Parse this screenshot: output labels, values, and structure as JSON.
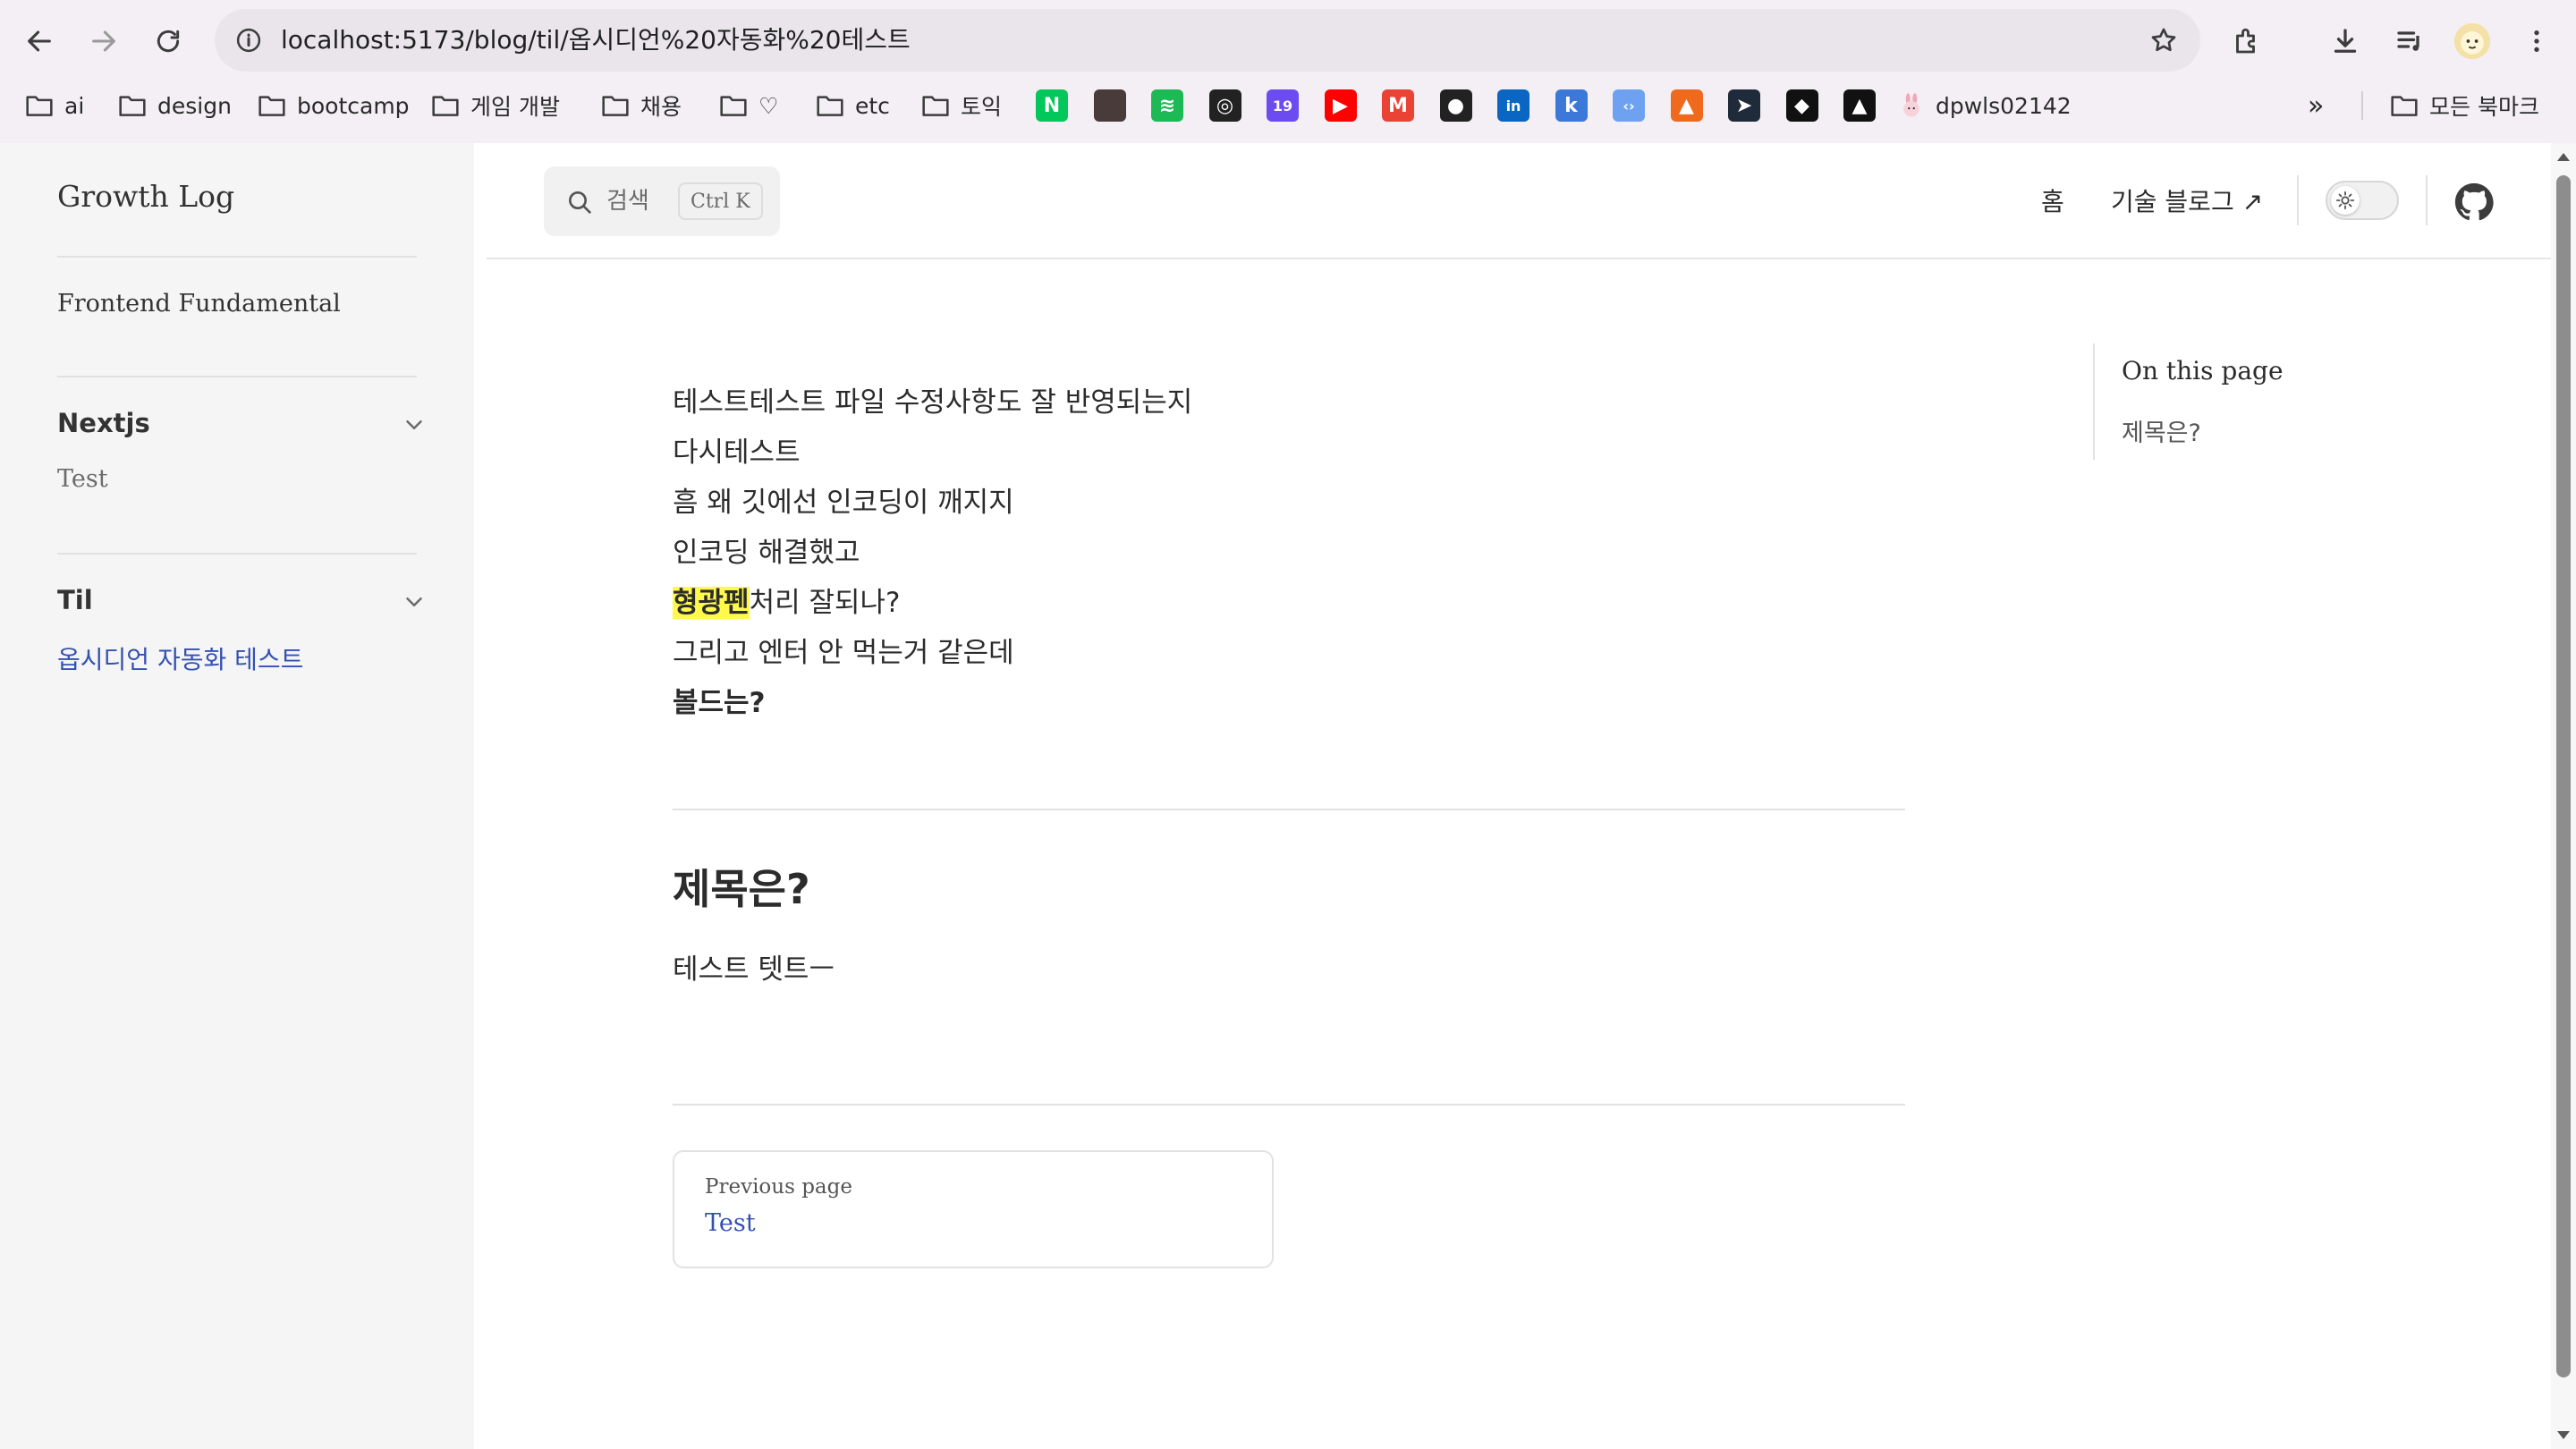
{
  "browser": {
    "url": "localhost:5173/blog/til/옵시디언%20자동화%20테스트",
    "bookmarks": [
      {
        "label": "ai",
        "icon": "folder-icon"
      },
      {
        "label": "design",
        "icon": "folder-icon"
      },
      {
        "label": "bootcamp",
        "icon": "folder-icon"
      },
      {
        "label": "게임 개발",
        "icon": "folder-icon"
      },
      {
        "label": "채용",
        "icon": "folder-icon"
      },
      {
        "label": "♡",
        "icon": "folder-icon"
      },
      {
        "label": "etc",
        "icon": "folder-icon"
      },
      {
        "label": "토익",
        "icon": "folder-icon"
      }
    ],
    "favicons": [
      {
        "name": "naver-icon",
        "glyph": "N",
        "color": "#03c75a"
      },
      {
        "name": "profile-image-icon",
        "glyph": "",
        "color": "#4a3b3b"
      },
      {
        "name": "spotify-icon",
        "glyph": "≋",
        "color": "#1db954"
      },
      {
        "name": "target-icon",
        "glyph": "◎",
        "color": "#222222"
      },
      {
        "name": "notification-19-icon",
        "glyph": "19",
        "color": "#6c4cf0"
      },
      {
        "name": "youtube-icon",
        "glyph": "▶",
        "color": "#ff0000"
      },
      {
        "name": "gmail-icon",
        "glyph": "M",
        "color": "#ea4335"
      },
      {
        "name": "github-icon",
        "glyph": "●",
        "color": "#222222"
      },
      {
        "name": "linkedin-icon",
        "glyph": "in",
        "color": "#0a66c2"
      },
      {
        "name": "k-icon",
        "glyph": "k",
        "color": "#3b78d8"
      },
      {
        "name": "code-icon",
        "glyph": "‹›",
        "color": "#6ea2f0"
      },
      {
        "name": "fire-icon",
        "glyph": "▲",
        "color": "#f06a1d"
      },
      {
        "name": "send-icon",
        "glyph": "➤",
        "color": "#1f2b3a"
      },
      {
        "name": "diamond-icon",
        "glyph": "◆",
        "color": "#111111"
      },
      {
        "name": "triangle-icon",
        "glyph": "▲",
        "color": "#111111"
      }
    ],
    "profile_bookmark": "dpwls02142",
    "overflow": "»",
    "all_bookmarks": "모든 북마크"
  },
  "sidebar": {
    "brand": "Growth Log",
    "top_link": "Frontend Fundamental",
    "groups": [
      {
        "title": "Nextjs",
        "items": [
          "Test"
        ]
      },
      {
        "title": "Til",
        "items": [
          "옵시디언 자동화 테스트"
        ]
      }
    ]
  },
  "header": {
    "search_placeholder": "검색",
    "search_shortcut": "Ctrl K",
    "nav_home": "홈",
    "nav_tech_blog": "기술 블로그 ↗"
  },
  "content": {
    "lines": [
      "테스트테스트 파일 수정사항도 잘 반영되는지",
      "다시테스트",
      "흠 왜 깃에선 인코딩이 깨지지",
      "인코딩 해결했고"
    ],
    "highlight": "형광펜",
    "highlight_rest": "처리 잘되나?",
    "line_after_highlight": "그리고 엔터 안 먹는거 같은데",
    "bold_line": "볼드는?",
    "heading": "제목은?",
    "heading_body": "테스트 텟트ㅡ",
    "prev_label": "Previous page",
    "prev_title": "Test"
  },
  "toc": {
    "title": "On this page",
    "items": [
      "제목은?"
    ]
  },
  "colors": {
    "accent": "#3451b2",
    "highlight": "#fff94d",
    "sidebar_bg": "#f5f5f5"
  }
}
